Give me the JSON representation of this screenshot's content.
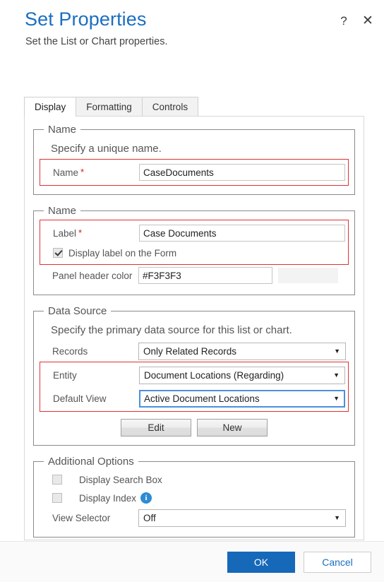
{
  "header": {
    "title": "Set Properties",
    "subtitle": "Set the List or Chart properties.",
    "help_icon": "?",
    "close_icon": "✕"
  },
  "tabs": [
    {
      "label": "Display",
      "active": true
    },
    {
      "label": "Formatting",
      "active": false
    },
    {
      "label": "Controls",
      "active": false
    }
  ],
  "sections": {
    "name_unique": {
      "legend": "Name",
      "description": "Specify a unique name.",
      "name_label": "Name",
      "name_required": "*",
      "name_value": "CaseDocuments"
    },
    "name_label_section": {
      "legend": "Name",
      "label_label": "Label",
      "label_required": "*",
      "label_value": "Case Documents",
      "display_label_checkbox": "Display label on the Form",
      "display_label_checked": true,
      "panel_header_color_label": "Panel header color",
      "panel_header_color_value": "#F3F3F3",
      "panel_header_color_swatch": "#F3F3F3"
    },
    "data_source": {
      "legend": "Data Source",
      "description": "Specify the primary data source for this list or chart.",
      "records_label": "Records",
      "records_value": "Only Related Records",
      "entity_label": "Entity",
      "entity_value": "Document Locations (Regarding)",
      "default_view_label": "Default View",
      "default_view_value": "Active Document Locations",
      "edit_button": "Edit",
      "new_button": "New"
    },
    "additional_options": {
      "legend": "Additional Options",
      "display_search_box_label": "Display Search Box",
      "display_search_box_checked": false,
      "display_index_label": "Display Index",
      "display_index_checked": false,
      "display_index_info_icon": "i",
      "view_selector_label": "View Selector",
      "view_selector_value": "Off"
    }
  },
  "footer": {
    "ok_label": "OK",
    "cancel_label": "Cancel"
  },
  "colors": {
    "accent": "#1668b8",
    "title": "#1b6ec2",
    "required": "#d41818",
    "highlight": "#e03131",
    "focus": "#4a90d9",
    "info": "#2d8bd4"
  },
  "icons": {
    "caret_down": "▼"
  }
}
